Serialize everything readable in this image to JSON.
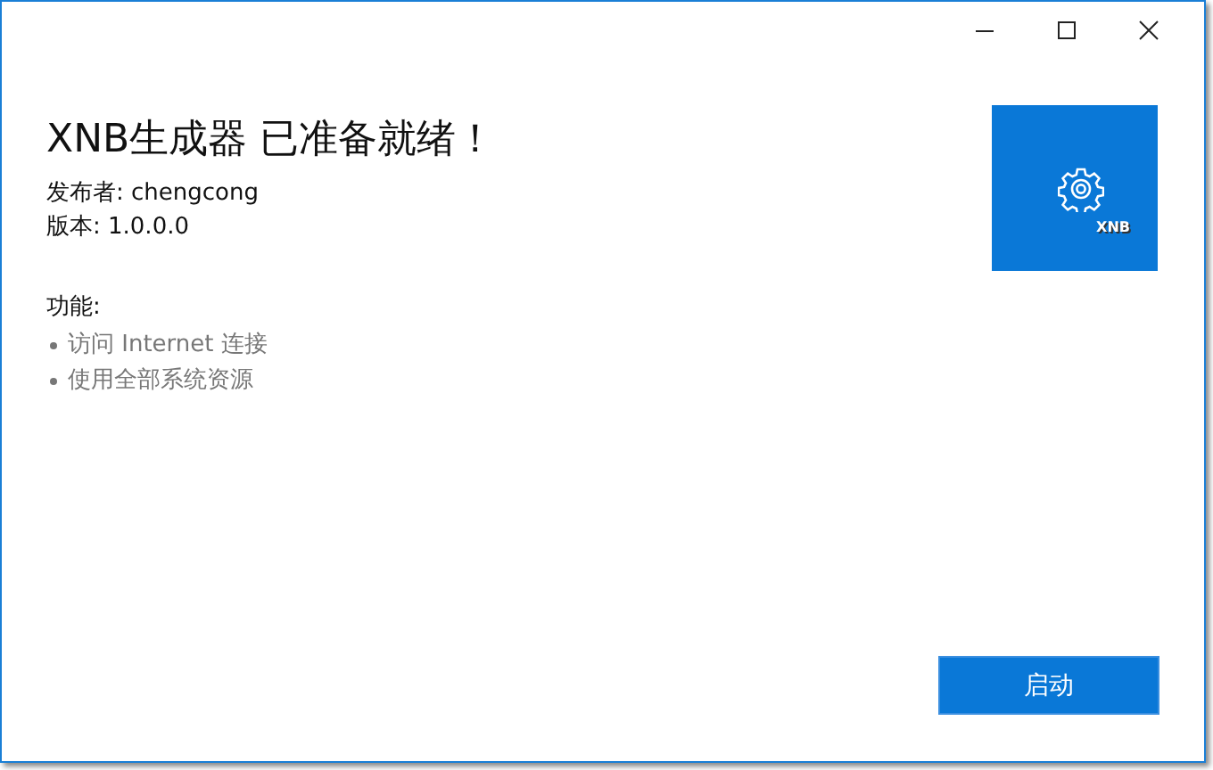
{
  "window": {
    "controls": [
      {
        "kind": "minimize"
      },
      {
        "kind": "maximize"
      },
      {
        "kind": "close"
      }
    ]
  },
  "title": "XNB生成器 已准备就绪！",
  "publisher": "发布者: chengcong",
  "version": "版本: 1.0.0.0",
  "capabilities": {
    "heading": "功能:",
    "items": [
      "访问 Internet 连接",
      "使用全部系统资源"
    ]
  },
  "logo": {
    "label": "XNB"
  },
  "launch_button": "启动"
}
